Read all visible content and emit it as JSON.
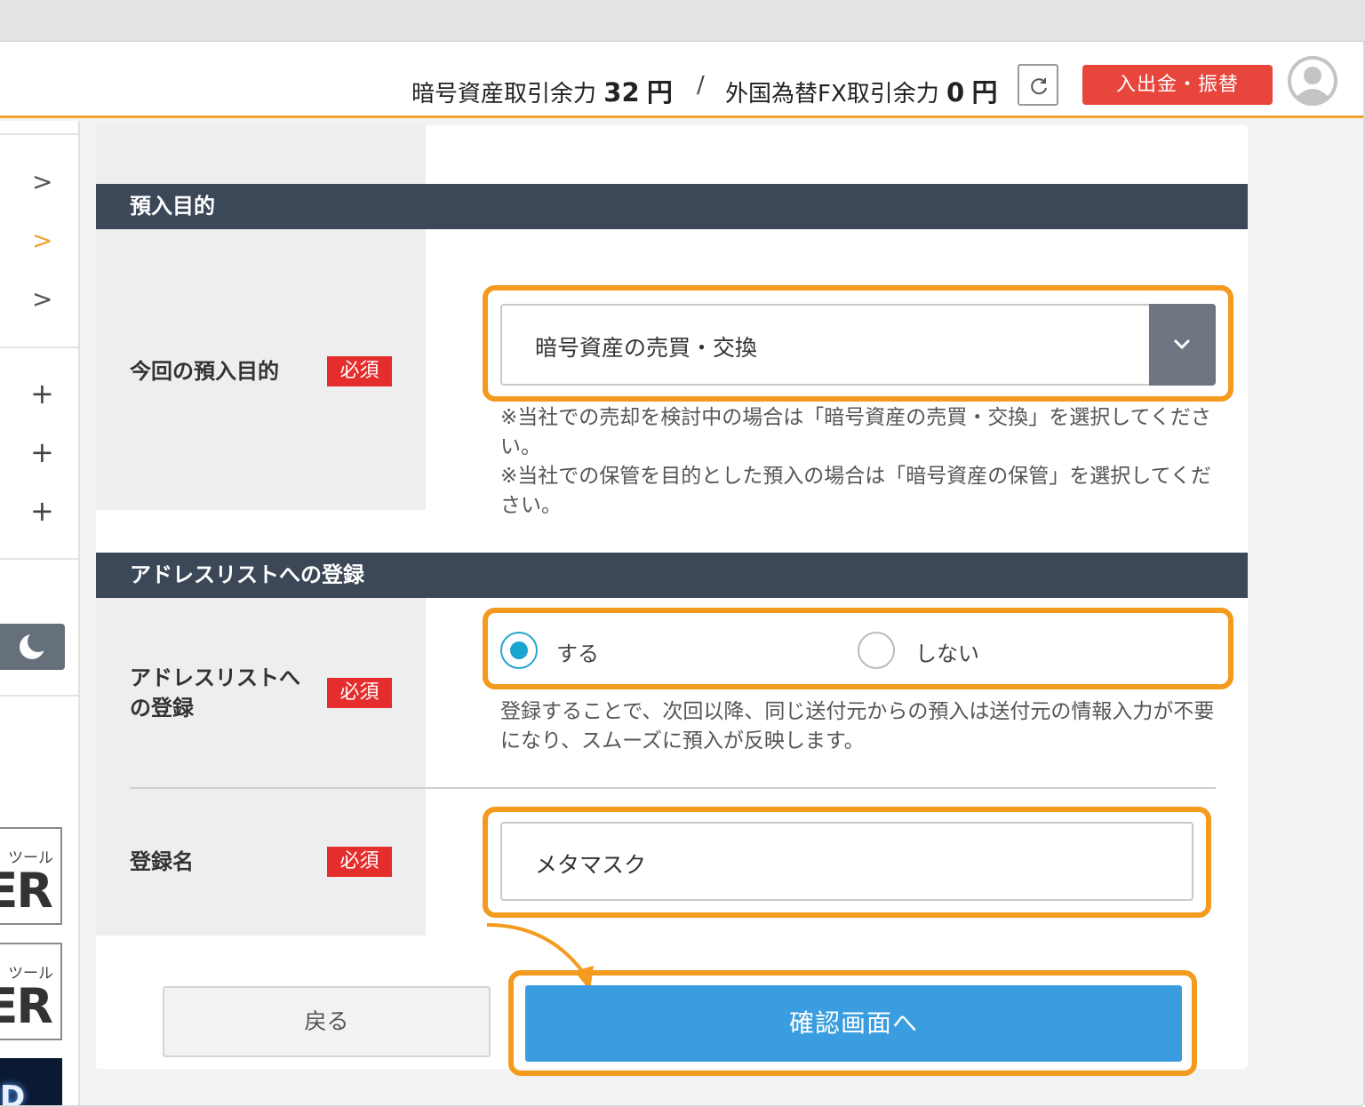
{
  "header": {
    "crypto_label": "暗号資産取引余力",
    "crypto_value": "32",
    "crypto_unit": "円",
    "separator": "/",
    "fx_label": "外国為替FX取引余力",
    "fx_value": "0",
    "fx_unit": "円",
    "refresh_icon": "refresh-icon",
    "deposit_button": "入出金・振替",
    "avatar_icon": "user-avatar-icon"
  },
  "sidebar": {
    "chevrons": [
      ">",
      ">",
      ">"
    ],
    "plus": [
      "+",
      "+",
      "+"
    ],
    "theme_icon": "moon-icon",
    "banners": [
      {
        "small": "ツール",
        "big": "ER"
      },
      {
        "small": "ツール",
        "big": "ER"
      }
    ],
    "dark_banner": "D"
  },
  "form": {
    "purpose_section": "預入目的",
    "purpose_label": "今回の預入目的",
    "required": "必須",
    "purpose_value": "暗号資産の売買・交換",
    "purpose_note_1": "※当社での売却を検討中の場合は「暗号資産の売買・交換」を選択してください。",
    "purpose_note_2": "※当社での保管を目的とした預入の場合は「暗号資産の保管」を選択してください。",
    "address_section": "アドレスリストへの登録",
    "address_label_line1": "アドレスリストへ",
    "address_label_line2": "の登録",
    "radio_yes": "する",
    "radio_no": "しない",
    "selected_option": "する",
    "address_note": "登録することで、次回以降、同じ送付元からの預入は送付元の情報入力が不要になり、スムーズに預入が反映します。",
    "name_label": "登録名",
    "name_value": "メタマスク",
    "back_button": "戻る",
    "confirm_button": "確認画面へ"
  },
  "colors": {
    "highlight": "#f39a1f",
    "section_header": "#3c4858",
    "required_badge": "#e52d2d",
    "deposit_button": "#e8453c",
    "confirm_button": "#3a9ddf",
    "radio_checked": "#1aa5d0"
  }
}
